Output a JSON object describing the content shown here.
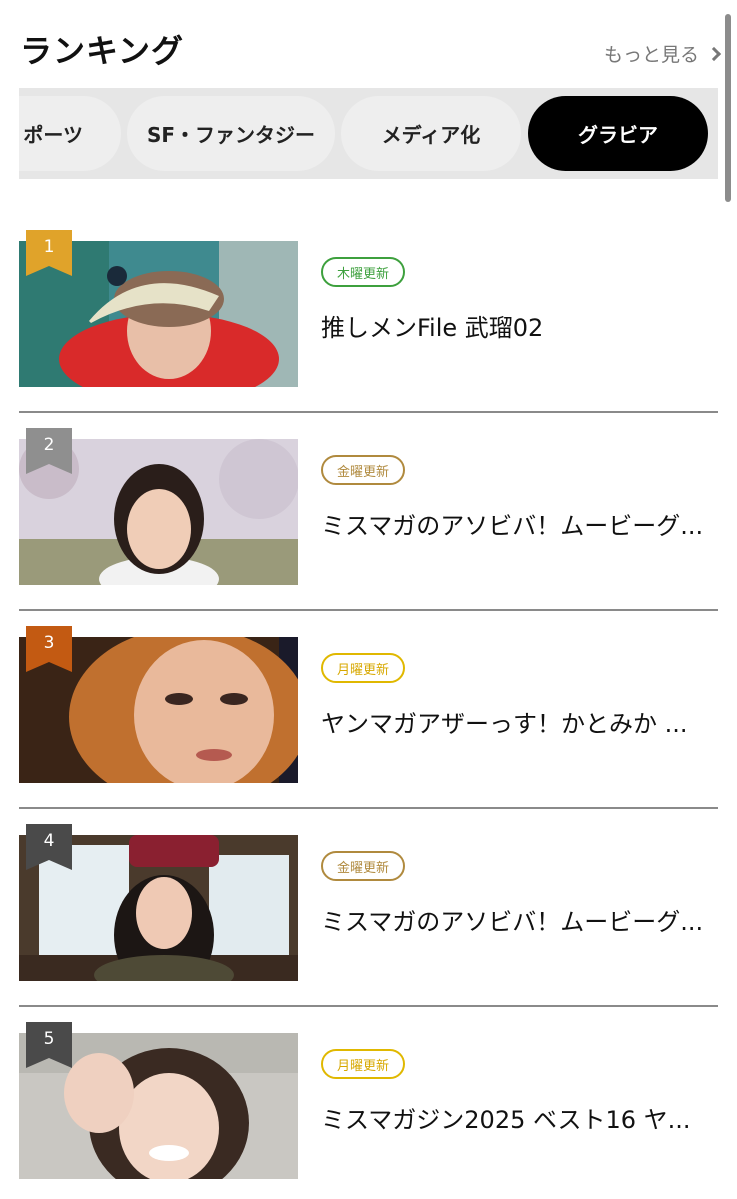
{
  "header": {
    "title": "ランキング",
    "more_label": "もっと見る"
  },
  "tabs": [
    {
      "label": "ポーツ",
      "active": false
    },
    {
      "label": "SF・ファンタジー",
      "active": false
    },
    {
      "label": "メディア化",
      "active": false
    },
    {
      "label": "グラビア",
      "active": true
    }
  ],
  "ranking": [
    {
      "rank": "1",
      "badge": "木曜更新",
      "badge_color": "#3da03d",
      "title": "推しメンFile 武瑠02",
      "rank_color": "#e0a32a"
    },
    {
      "rank": "2",
      "badge": "金曜更新",
      "badge_color": "#b08a3e",
      "title": "ミスマガのアソビバ！ムービーグ...",
      "rank_color": "#8f8f8f"
    },
    {
      "rank": "3",
      "badge": "月曜更新",
      "badge_color": "#d7a800",
      "title": "ヤンマガアザーっす！かとみか ...",
      "rank_color": "#c35a12"
    },
    {
      "rank": "4",
      "badge": "金曜更新",
      "badge_color": "#b08a3e",
      "title": "ミスマガのアソビバ！ムービーグ...",
      "rank_color": "#4a4a4a"
    },
    {
      "rank": "5",
      "badge": "月曜更新",
      "badge_color": "#d7a800",
      "title": "ミスマガジン2025 ベスト16 ヤ...",
      "rank_color": "#4a4a4a"
    }
  ]
}
